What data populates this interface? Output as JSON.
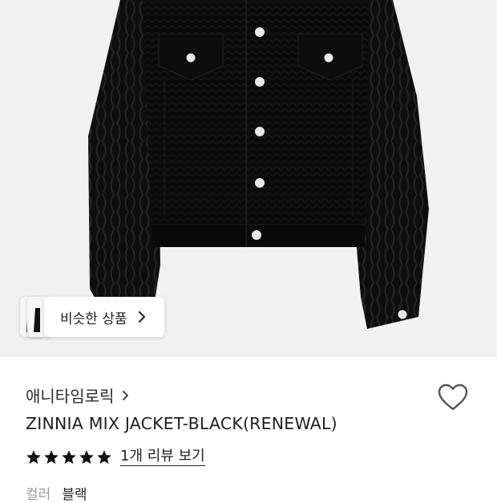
{
  "hero": {
    "image": "black-jacket-product-photo"
  },
  "similar": {
    "label": "비슷한 상품"
  },
  "brand": {
    "name": "애니타임로릭"
  },
  "product": {
    "name": "ZINNIA MIX JACKET-BLACK(RENEWAL)"
  },
  "rating": {
    "stars": 5,
    "max_stars": 5,
    "review_link": "1개 리뷰 보기"
  },
  "color": {
    "label": "컬러",
    "value": "블랙"
  },
  "icons": {
    "wishlist": "heart-outline-icon",
    "brand_arrow": "chevron-right-icon",
    "similar_arrow": "chevron-right-icon",
    "star": "star-filled-icon"
  },
  "colors": {
    "background": "#ffffff",
    "photo_bg": "#f1f1f1",
    "text": "#1f1f1f",
    "muted": "#9a9a9a",
    "jacket": "#0b0b0b"
  }
}
